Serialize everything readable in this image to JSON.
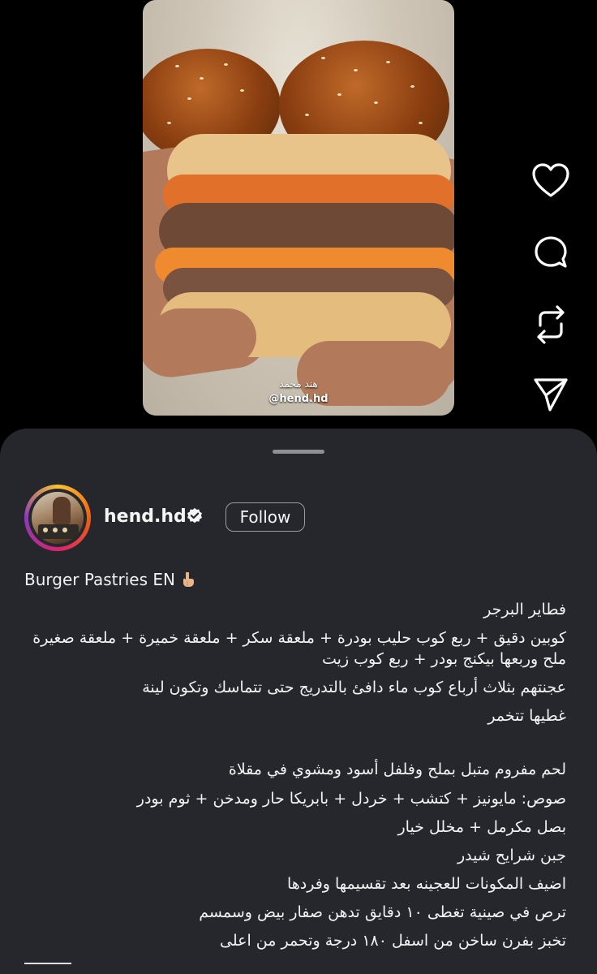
{
  "video": {
    "watermark_name": "هند محمد",
    "watermark_handle": "@hend.hd"
  },
  "actions": [
    {
      "name": "like-icon"
    },
    {
      "name": "comment-icon"
    },
    {
      "name": "repost-icon"
    },
    {
      "name": "share-icon"
    }
  ],
  "profile": {
    "username": "hend.hd",
    "verified": true,
    "follow_label": "Follow"
  },
  "caption": {
    "title": "Burger Pastries EN",
    "title_emoji": "pointing-down-emoji",
    "lines": [
      "فطاير البرجر",
      "كوبين دقيق + ربع كوب حليب بودرة + ملعقة سكر + ملعقة خميرة + ملعقة صغيرة ملح وربعها بيكنج بودر + ربع كوب زيت",
      "عجنتهم بثلاث أرباع كوب ماء دافئ بالتدريج حتى تتماسك وتكون لينة",
      "غطيها تتخمر",
      "لحم مفروم متبل بملح وفلفل أسود ومشوي في مقلاة",
      "صوص: مايونيز + كتشب + خردل + بابريكا حار ومدخن + ثوم بودر",
      "بصل مكرمل + مخلل خيار",
      "جبن شرايح شيدر",
      "اضيف المكونات للعجينه بعد تقسيمها وفردها",
      "ترص في صينية تغطى ١٠ دقايق تدهن صفار بيض وسمسم",
      "تخبز بفرن ساخن من اسفل ١٨٠ درجة وتحمر من اعلى"
    ]
  },
  "colors": {
    "sheet": "#25272c",
    "background": "#000000"
  }
}
